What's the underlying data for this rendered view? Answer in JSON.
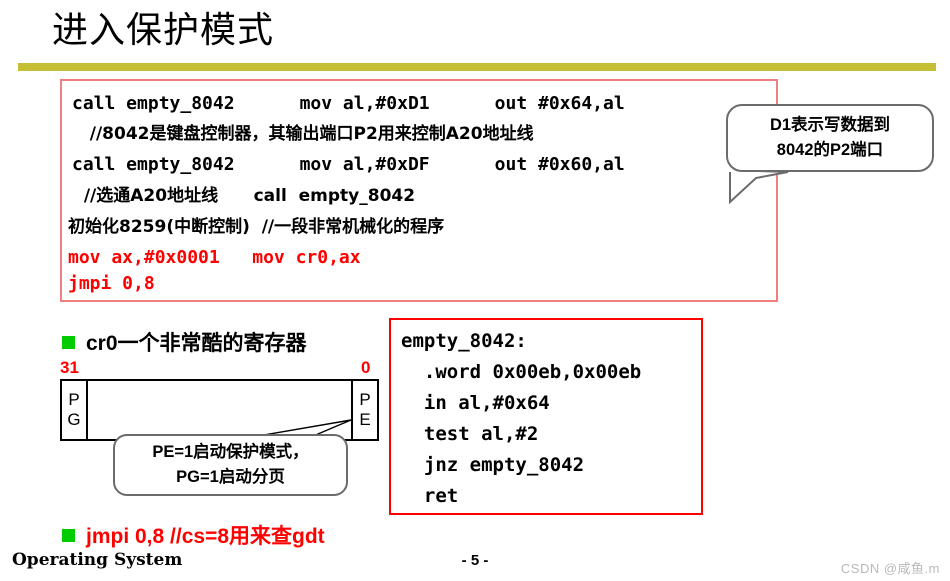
{
  "slide": {
    "title": "进入保护模式",
    "accent_rule_color": "#c5bf35",
    "page_number": "- 5 -",
    "footer_label": "Operating System",
    "watermark": "CSDN @咸鱼.m"
  },
  "code_panel": {
    "border_color": "#f08080",
    "lines": [
      {
        "id": "l1",
        "text": "call empty_8042      mov al,#0xD1      out #0x64,al",
        "color": "#000000"
      },
      {
        "id": "l2",
        "text": "   //8042是键盘控制器，其输出端口P2用来控制A20地址线",
        "color": "#000000"
      },
      {
        "id": "l3",
        "text": "call empty_8042      mov al,#0xDF      out #0x60,al",
        "color": "#000000"
      },
      {
        "id": "l4",
        "text": "  //选通A20地址线      call  empty_8042",
        "color": "#000000"
      },
      {
        "id": "l5",
        "text": "初始化8259(中断控制)  //一段非常机械化的程序",
        "color": "#000000"
      },
      {
        "id": "l6",
        "text": "mov ax,#0x0001   mov cr0,ax",
        "color": "#ff0000"
      },
      {
        "id": "l7",
        "text": "jmpi 0,8",
        "color": "#ff0000"
      }
    ]
  },
  "callout_d1": {
    "line1": "D1表示写数据到",
    "line2": "8042的P2端口"
  },
  "cr0_bullet": {
    "text": "cr0一个非常酷的寄存器",
    "marker_color": "#00cc00"
  },
  "register": {
    "label_high": "31",
    "label_low": "0",
    "high_bit_name_top": "P",
    "high_bit_name_bottom": "G",
    "low_bit_name_top": "P",
    "low_bit_name_bottom": "E",
    "label_color": "#ff0000"
  },
  "callout_pe": {
    "line1": "PE=1启动保护模式，",
    "line2": "PG=1启动分页"
  },
  "empty_panel": {
    "border_color": "#ff0000",
    "lines": [
      {
        "id": "e1",
        "text": "empty_8042:"
      },
      {
        "id": "e2",
        "text": "  .word 0x00eb,0x00eb"
      },
      {
        "id": "e3",
        "text": "  in al,#0x64"
      },
      {
        "id": "e4",
        "text": "  test al,#2"
      },
      {
        "id": "e5",
        "text": "  jnz empty_8042"
      },
      {
        "id": "e6",
        "text": "  ret"
      }
    ]
  },
  "jmpi_bullet": {
    "text": "jmpi 0,8 //cs=8用来查gdt",
    "marker_color": "#00cc00",
    "text_color": "#ff0000"
  }
}
